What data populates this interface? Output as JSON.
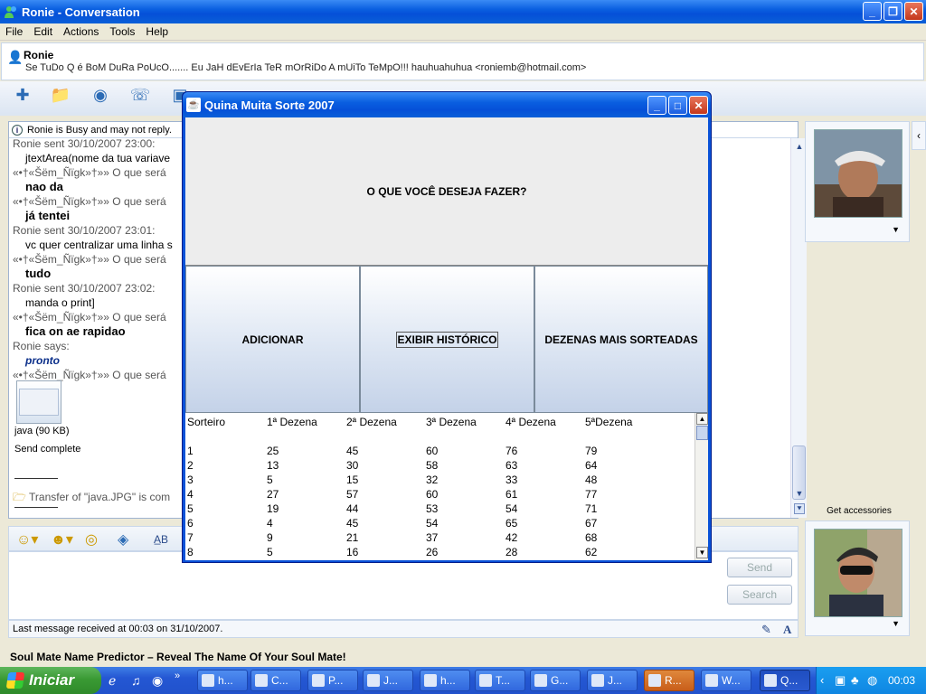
{
  "window": {
    "title": "Ronie - Conversation",
    "menu": [
      "File",
      "Edit",
      "Actions",
      "Tools",
      "Help"
    ]
  },
  "contact": {
    "name": "Ronie",
    "personal_message": "Se TuDo Q é BoM DuRa PoUcO....... Eu JaH dEvErIa TeR mOrRiDo A mUiTo TeMpO!!! hauhuahuhua <roniemb@hotmail.com>"
  },
  "conversation": {
    "busy_notice": "Ronie is Busy and may not reply.",
    "messages": [
      {
        "type": "hdr",
        "text": "Ronie sent 30/10/2007 23:00:"
      },
      {
        "type": "body",
        "text": "jtextArea(nome da tua variave"
      },
      {
        "type": "hdr",
        "text": "«•†«Šëm_Ñïgk»†»» O que será"
      },
      {
        "type": "bold",
        "text": "nao da"
      },
      {
        "type": "hdr",
        "text": "«•†«Šëm_Ñïgk»†»» O que será"
      },
      {
        "type": "bold",
        "text": "já tentei"
      },
      {
        "type": "hdr",
        "text": "Ronie sent 30/10/2007 23:01:"
      },
      {
        "type": "body",
        "text": "vc quer centralizar uma linha s"
      },
      {
        "type": "hdr",
        "text": "«•†«Šëm_Ñïgk»†»» O que será"
      },
      {
        "type": "bold",
        "text": "tudo"
      },
      {
        "type": "hdr",
        "text": "Ronie sent 30/10/2007 23:02:"
      },
      {
        "type": "body",
        "text": "manda o print]"
      },
      {
        "type": "hdr",
        "text": "«•†«Šëm_Ñïgk»†»» O que será"
      },
      {
        "type": "bold",
        "text": "fica on ae rapidao"
      },
      {
        "type": "hdr",
        "text": "Ronie says:"
      },
      {
        "type": "blueital",
        "text": "pronto"
      },
      {
        "type": "hdr",
        "text": "«•†«Šëm_Ñïgk»†»» O que será"
      }
    ],
    "file_caption": "java (90 KB)",
    "send_complete": "Send complete",
    "transfer_text": "Transfer of \"java.JPG\" is com"
  },
  "sidebar": {
    "get_accessories": "Get accessories"
  },
  "input": {
    "send_label": "Send",
    "search_label": "Search"
  },
  "status": {
    "last_message": "Last message received at 00:03 on 31/10/2007."
  },
  "ad": {
    "text": "Soul Mate Name Predictor – Reveal The Name Of Your Soul Mate!"
  },
  "dialog": {
    "title": "Quina Muita Sorte 2007",
    "question": "O QUE VOCÊ DESEJA FAZER?",
    "buttons": [
      "ADICIONAR",
      "EXIBIR HISTÓRICO",
      "DEZENAS MAIS SORTEADAS"
    ],
    "table": {
      "headers": [
        "Sorteiro",
        "1ª Dezena",
        "2ª Dezena",
        "3ª Dezena",
        "4ª Dezena",
        "5ªDezena"
      ],
      "rows": [
        [
          "1",
          "25",
          "45",
          "60",
          "76",
          "79"
        ],
        [
          "2",
          "13",
          "30",
          "58",
          "63",
          "64"
        ],
        [
          "3",
          "5",
          "15",
          "32",
          "33",
          "48"
        ],
        [
          "4",
          "27",
          "57",
          "60",
          "61",
          "77"
        ],
        [
          "5",
          "19",
          "44",
          "53",
          "54",
          "71"
        ],
        [
          "6",
          "4",
          "45",
          "54",
          "65",
          "67"
        ],
        [
          "7",
          "9",
          "21",
          "37",
          "42",
          "68"
        ],
        [
          "8",
          "5",
          "16",
          "26",
          "28",
          "62"
        ]
      ]
    }
  },
  "taskbar": {
    "start_label": "Iniciar",
    "tasks": [
      "h...",
      "C...",
      "P...",
      "J...",
      "h...",
      "T...",
      "G...",
      "J...",
      "R...",
      "W...",
      "Q..."
    ],
    "clock": "00:03"
  }
}
